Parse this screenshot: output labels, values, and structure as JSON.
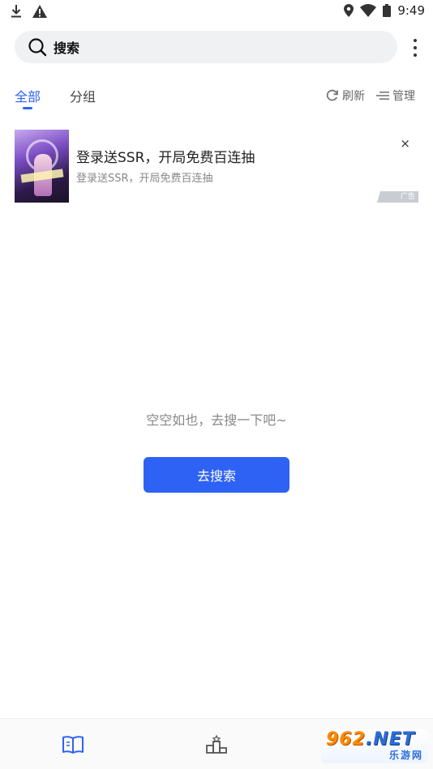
{
  "status_bar": {
    "time": "9:49",
    "left_icons": [
      "download-icon",
      "warning-icon"
    ],
    "right_icons": [
      "location-icon",
      "wifi-icon",
      "battery-icon"
    ]
  },
  "search": {
    "placeholder": "搜索"
  },
  "tabs": [
    {
      "label": "全部",
      "active": true
    },
    {
      "label": "分组",
      "active": false
    }
  ],
  "actions": {
    "refresh": "刷新",
    "manage": "管理"
  },
  "ad": {
    "title": "登录送SSR，开局免费百连抽",
    "subtitle": "登录送SSR，开局免费百连抽",
    "close": "×",
    "badge": "广告"
  },
  "empty_state": {
    "message": "空空如也，去搜一下吧~",
    "button": "去搜索"
  },
  "bottom_nav": {
    "items": [
      {
        "icon": "book-icon",
        "active": true
      },
      {
        "icon": "ranking-icon",
        "active": false
      }
    ]
  },
  "watermark": {
    "brand": "962",
    "suffix": ".NET",
    "subtitle": "乐游网"
  },
  "colors": {
    "accent": "#2e62f4",
    "search_bg": "#f0f1f3",
    "muted_text": "#888888"
  }
}
